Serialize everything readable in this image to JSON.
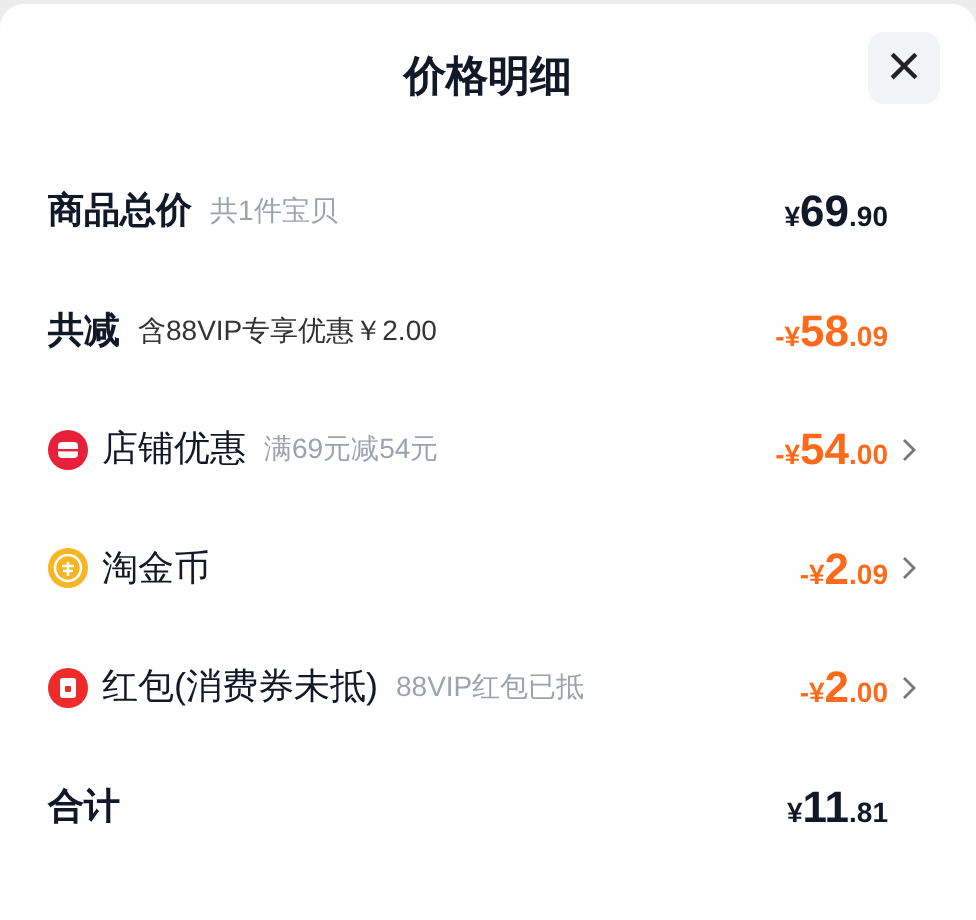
{
  "dialog": {
    "title": "价格明细",
    "close_label": "×"
  },
  "rows": [
    {
      "kind": "summary",
      "label": "商品总价",
      "note": "共1件宝贝",
      "negative": false,
      "expandable": false,
      "amount": {
        "currency": "¥",
        "integer": "69",
        "decimal": ".90"
      }
    },
    {
      "kind": "summary",
      "label": "共减",
      "note": "含88VIP专享优惠￥2.00",
      "negative": true,
      "expandable": false,
      "amount": {
        "currency": "-¥",
        "integer": "58",
        "decimal": ".09"
      }
    },
    {
      "kind": "store",
      "label": "店铺优惠",
      "note": "满69元减54元",
      "negative": true,
      "expandable": true,
      "amount": {
        "currency": "-¥",
        "integer": "54",
        "decimal": ".00"
      }
    },
    {
      "kind": "coins",
      "label": "淘金币",
      "negative": true,
      "expandable": true,
      "amount": {
        "currency": "-¥",
        "integer": "2",
        "decimal": ".09"
      }
    },
    {
      "kind": "envelope",
      "label": "红包(消费券未抵)",
      "note": "88VIP红包已抵",
      "negative": true,
      "expandable": true,
      "amount": {
        "currency": "-¥",
        "integer": "2",
        "decimal": ".00"
      }
    },
    {
      "kind": "summary",
      "label": "合计",
      "negative": false,
      "expandable": false,
      "amount": {
        "currency": "¥",
        "integer": "11",
        "decimal": ".81"
      }
    }
  ]
}
